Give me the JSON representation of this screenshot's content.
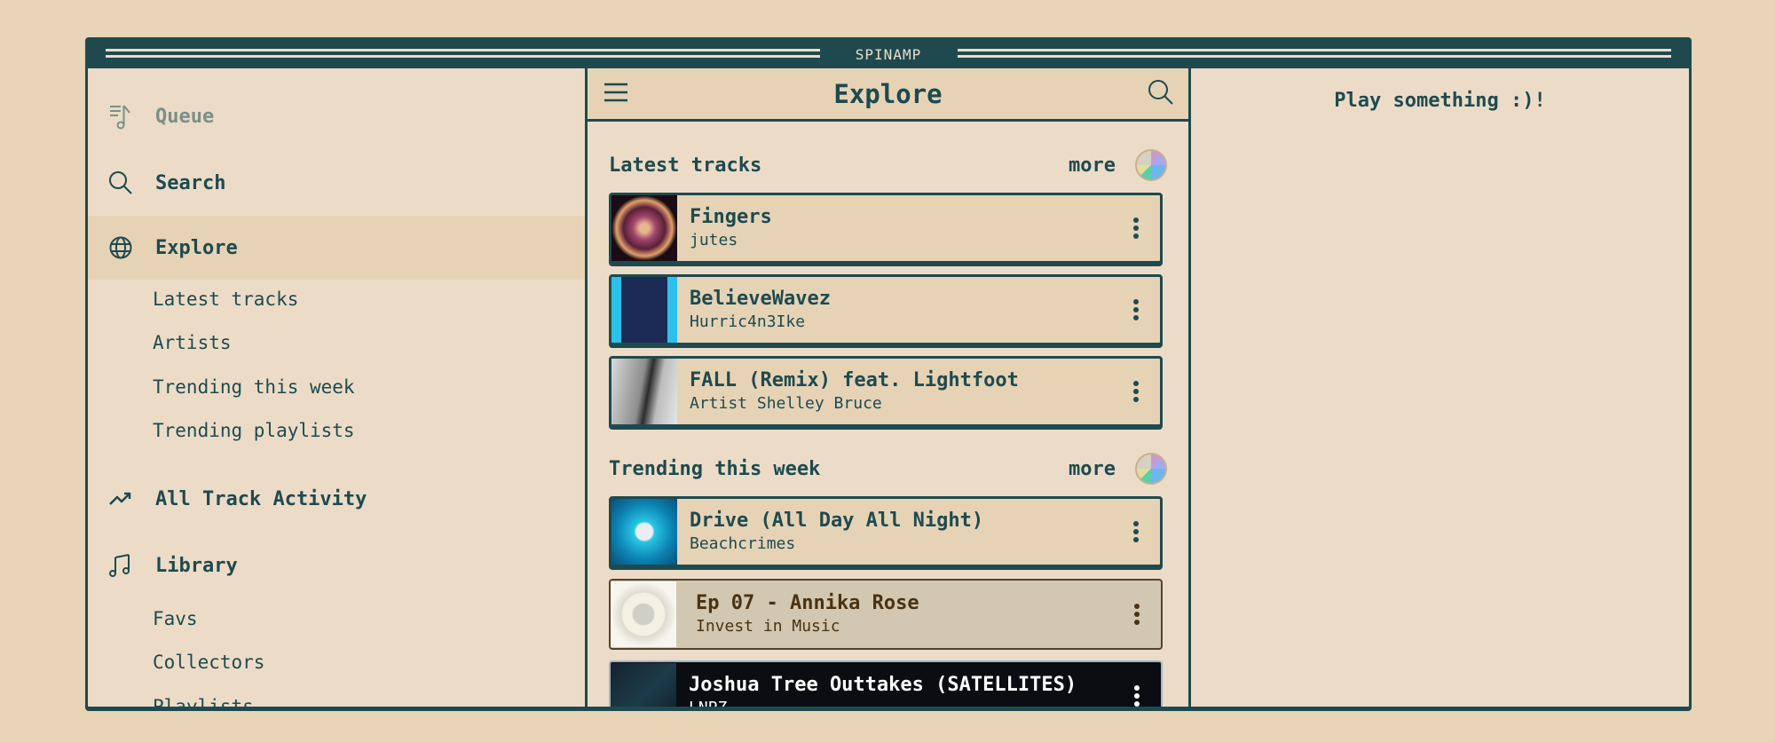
{
  "window": {
    "title": "SPINAMP"
  },
  "sidebar": {
    "items": [
      {
        "label": "Queue",
        "icon": "queue-icon"
      },
      {
        "label": "Search",
        "icon": "search-icon"
      },
      {
        "label": "Explore",
        "icon": "globe-icon"
      },
      {
        "label": "All Track Activity",
        "icon": "trending-icon"
      },
      {
        "label": "Library",
        "icon": "music-notes-icon"
      }
    ],
    "explore_sub": [
      "Latest tracks",
      "Artists",
      "Trending this week",
      "Trending playlists"
    ],
    "library_sub": [
      "Favs",
      "Collectors",
      "Playlists"
    ]
  },
  "main": {
    "title": "Explore",
    "sections": [
      {
        "title": "Latest tracks",
        "more_label": "more",
        "tracks": [
          {
            "title": "Fingers",
            "artist": "jutes"
          },
          {
            "title": "BelieveWavez",
            "artist": "Hurric4n3Ike"
          },
          {
            "title": "FALL (Remix) feat. Lightfoot",
            "artist": "Artist Shelley Bruce"
          }
        ]
      },
      {
        "title": "Trending this week",
        "more_label": "more",
        "tracks": [
          {
            "title": "Drive (All Day All Night)",
            "artist": "Beachcrimes"
          },
          {
            "title": "Ep 07 - Annika Rose",
            "artist": "Invest in Music"
          },
          {
            "title": "Joshua Tree Outtakes (SATELLITES)",
            "artist": "LNPZ"
          }
        ]
      }
    ]
  },
  "player": {
    "empty_message": "Play something :)!"
  },
  "colors": {
    "primary": "#1e4a4f",
    "background": "#ecdcc7",
    "accent_bg": "#e6d3b6",
    "page_bg": "#e8d4b6"
  }
}
